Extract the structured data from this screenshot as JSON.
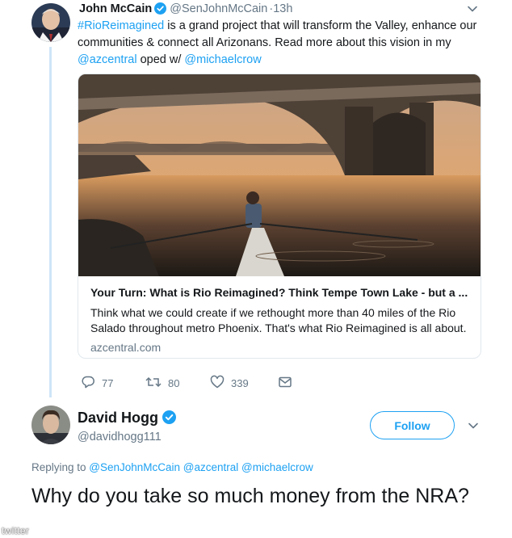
{
  "tweet1": {
    "author_name": "John McCain",
    "handle": "@SenJohnMcCain",
    "time": "·13h",
    "text_parts": {
      "hashtag": "#RioReimagined",
      "t1": " is a grand project that will transform the Valley, enhance our communities & connect all Arizonans. Read more about this vision in my ",
      "mention1": "@azcentral",
      "t2": " oped w/ ",
      "mention2": "@michaelcrow"
    },
    "card": {
      "title": "Your Turn: What is Rio Reimagined? Think Tempe Town Lake - but a ...",
      "description": "Think what we could create if we rethought more than 40 miles of the Rio Salado throughout metro Phoenix. That's what Rio Reimagined is all about.",
      "domain": "azcentral.com"
    },
    "actions": {
      "replies": "77",
      "retweets": "80",
      "likes": "339"
    }
  },
  "tweet2": {
    "author_name": "David Hogg",
    "handle": "@davidhogg111",
    "follow_label": "Follow",
    "replying_label": "Replying to ",
    "replying_mentions": "@SenJohnMcCain @azcentral @michaelcrow",
    "text": "Why do you take so much money from the NRA?"
  },
  "watermark": "twitter",
  "colors": {
    "accent": "#1da1f2",
    "muted": "#657786",
    "text": "#14171a",
    "thread_line": "#cfe5f7"
  },
  "icons": {
    "reply": "reply-icon",
    "retweet": "retweet-icon",
    "like": "heart-icon",
    "dm": "envelope-icon",
    "verified": "verified-badge-icon",
    "menu": "chevron-down-icon"
  }
}
